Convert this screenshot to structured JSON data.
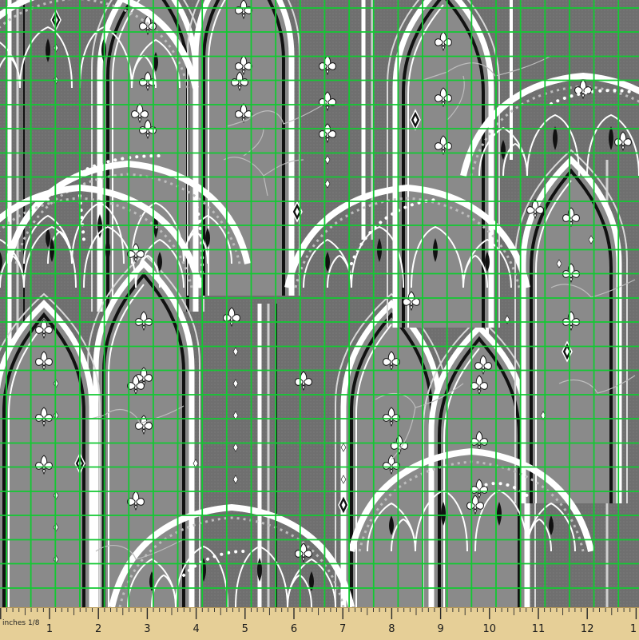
{
  "image": {
    "background": "#6f6f6f",
    "panel_color": "#858585",
    "lace_color": "#ffffff",
    "shadow_color": "#111111",
    "grid_color": "#12c932",
    "grid_cell": "1/8 inch",
    "subject": "gothic cathedral arches pattern with fleur-de-lis and hummingbirds, fabric swatch"
  },
  "ruler": {
    "caption": "inches 1/8",
    "color": "#e6cf97",
    "labels": [
      "1",
      "2",
      "3",
      "4",
      "5",
      "6",
      "7",
      "8",
      "9",
      "10",
      "11",
      "12",
      "1"
    ]
  }
}
